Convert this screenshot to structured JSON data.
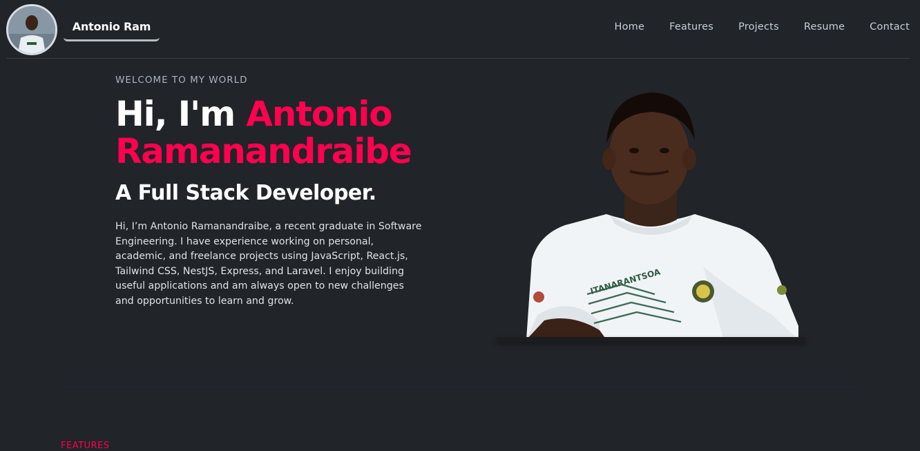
{
  "header": {
    "brand_name": "Antonio Ram",
    "nav": [
      {
        "label": "Home"
      },
      {
        "label": "Features"
      },
      {
        "label": "Projects"
      },
      {
        "label": "Resume"
      },
      {
        "label": "Contact"
      }
    ]
  },
  "hero": {
    "eyebrow": "WELCOME TO MY WORLD",
    "greeting": "Hi, I'm ",
    "name_line1": "Antonio",
    "name_line2": "Ramanandraibe",
    "subtitle": "A Full Stack Developer.",
    "bio": "Hi, I’m Antonio Ramanandraibe, a recent graduate in Software Engineering. I have experience working on personal, academic, and freelance projects using JavaScript, React.js, Tailwind CSS, NestJS, Express, and Laravel. I enjoy building useful applications and am always open to new challenges and opportunities to learn and grow.",
    "shirt_text": "ITANARANTSOA"
  },
  "features": {
    "label": "FEATURES"
  },
  "colors": {
    "background": "#212428",
    "accent": "#ff014f",
    "text": "#c4cfde"
  }
}
